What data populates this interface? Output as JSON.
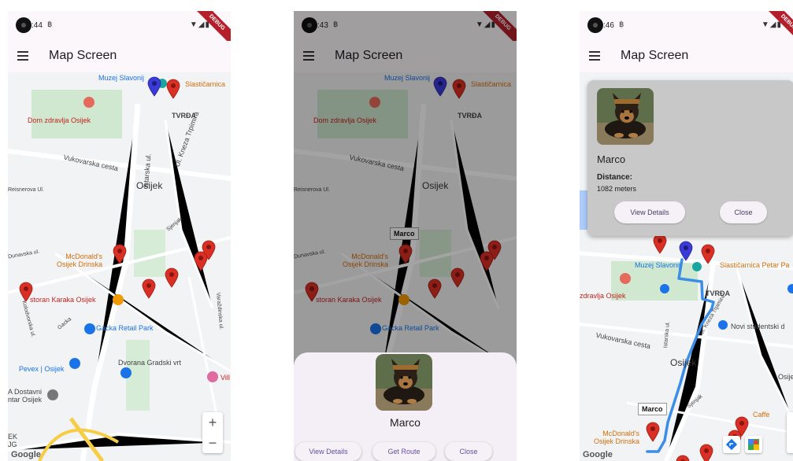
{
  "app": {
    "title": "Map Screen",
    "debug_banner": "DEBUG",
    "sim_glyph": "฿",
    "sys_icons": "▼◢▮"
  },
  "screens": [
    {
      "status_time": ":44"
    },
    {
      "status_time": ":43"
    },
    {
      "status_time": ":46"
    }
  ],
  "map": {
    "labels_1": {
      "muzej": "Muzej Slavonij",
      "slasticarnica": "Slastičarnica",
      "dom_zdravlja": "Dom zdravlja Osijek",
      "tvrda": "TVRĐA",
      "vukovarska": "Vukovarska cesta",
      "kneza_trpimira": "Ul. Kneza Trpimira",
      "istarska": "Istarska ul.",
      "osijek": "Osijek",
      "reisnerova": "Reisnerova Ul.",
      "sjenjak": "Sjenjak",
      "dunavska": "Dunavska ul.",
      "mcdonalds": "McDonald's\nOsijek Drinska",
      "restoran": "storan Karaka Osijek",
      "gacka_ul": "Gacka",
      "gacka_park": "Gacka Retail Park",
      "kolodvorska": "Kolodvorska ul.",
      "varazdinska": "Varaždinska ul.",
      "dvorana": "Dvorana Gradski vrt",
      "pevex": "Pevex | Osijek",
      "dostavni": "A Dostavni\nntar Osijek",
      "vill": "Vill",
      "ek_g": "EK\nJG"
    },
    "labels_3": {
      "muzej": "Muzej Slavonij",
      "slasticarnica": "Slastičarnica Petar Pa",
      "zdravlja": "zdravlja Osijek",
      "tvrda": "TVRĐA",
      "novi_studentski": "Novi studentski d",
      "vukovarska": "Vukovarska cesta",
      "kneza_trpimira": "Ul. Kneza Trpimira",
      "istarska": "Istarska ul.",
      "osijek": "Osijek",
      "osije": "Osije",
      "sjenjak": "Sjenjak",
      "caffe": "Caffe",
      "mcdonalds": "McDonald's\nOsijek Drinska"
    },
    "google_logo": "Google",
    "zoom_in": "+",
    "zoom_out": "−"
  },
  "marker_tooltip": "Marco",
  "bottom_sheet": {
    "name": "Marco",
    "buttons": [
      "View Details",
      "Get Route",
      "Close"
    ]
  },
  "info_card": {
    "name": "Marco",
    "distance_label": "Distance:",
    "distance_value": "1082 meters",
    "view_details": "View Details",
    "close": "Close"
  },
  "colors": {
    "pin_red": "#d93025",
    "pin_blue": "#3a3ad8",
    "route_blue": "#3a8ee8",
    "appbar_bg": "#fcf7fb",
    "button_text": "#6750a4"
  },
  "icons": {
    "menu": "menu-icon",
    "dog_photo": "dog-photo",
    "hospital": "hospital-icon",
    "restaurant": "restaurant-icon",
    "shopping": "shopping-bag-icon",
    "directions": "directions-icon",
    "maps": "google-maps-icon"
  }
}
